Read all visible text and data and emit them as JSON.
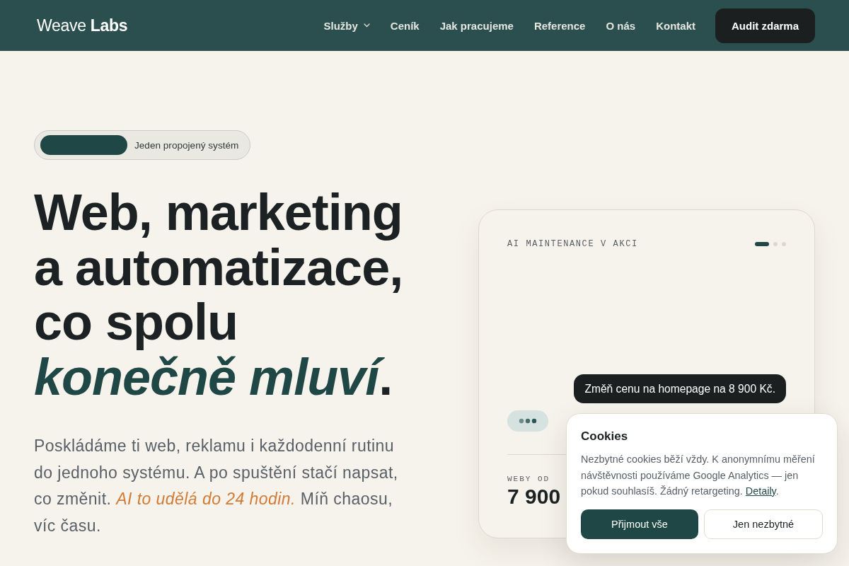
{
  "header": {
    "logo": "Weave **Labs**",
    "nav": [
      {
        "label": "Služby",
        "dropdown": true
      },
      {
        "label": "Ceník",
        "dropdown": false
      },
      {
        "label": "Jak pracujeme",
        "dropdown": false
      },
      {
        "label": "Reference",
        "dropdown": false
      },
      {
        "label": "O nás",
        "dropdown": false
      },
      {
        "label": "Kontakt",
        "dropdown": false
      }
    ],
    "cta": "Audit zdarma"
  },
  "hero": {
    "badge": "Jeden propojený systém",
    "title_lines": [
      "Web, marketing",
      "a automatizace,",
      "co spolu",
      "*konečně mluví*."
    ],
    "lead_lines": [
      "Poskládáme ti web, reklamu i každodenní rutinu",
      "do jednoho systému. A po spuštění stačí napsat,",
      "co změnit. *AI to udělá do 24 hodin.* Míň chaosu,",
      "víc času."
    ]
  },
  "demo_card": {
    "label": "AI MAINTENANCE V AKCI",
    "slides": [
      {
        "selected": true
      },
      {
        "selected": false
      },
      {
        "selected": false
      }
    ],
    "message": "Změň cenu na homepage na 8 900 Kč.",
    "typing": true,
    "price_label": "WEBY OD",
    "price": "7 900"
  },
  "cookie_banner": {
    "title": "Cookies",
    "text": "Nezbytné cookies běží vždy. K anonymnímu měření návštěvnosti používáme Google Analytics — jen pokud souhlasíš. Žádný retargeting.",
    "link": "Detaily",
    "text_after": ".",
    "buttons": [
      {
        "label": "Přijmout vše",
        "kind": "primary"
      },
      {
        "label": "Jen nezbytné",
        "kind": "secondary"
      }
    ]
  }
}
